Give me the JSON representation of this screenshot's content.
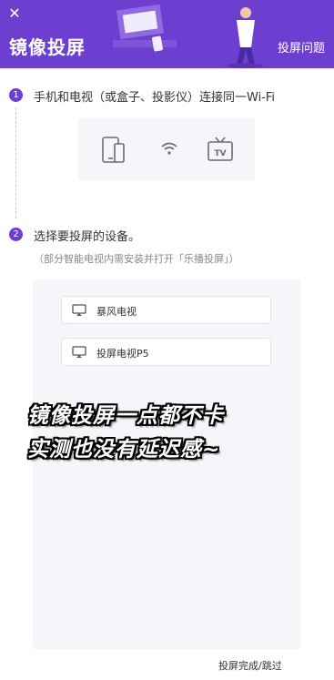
{
  "header": {
    "close_glyph": "✕",
    "title": "镜像投屏",
    "help_label": "投屏问题",
    "bg_color": "#6c3fd1"
  },
  "steps": [
    {
      "number": "1",
      "text": "手机和电视（或盒子、投影仪）连接同一Wi-Fi"
    },
    {
      "number": "2",
      "text": "选择要投屏的设备。",
      "note": "（部分智能电视内需安装并打开「乐播投屏」）"
    }
  ],
  "step1_icons": [
    "phone-icon",
    "wifi-icon",
    "tv-icon"
  ],
  "step1_tv_label": "TV",
  "devices": [
    {
      "name": "暴风电视",
      "icon": "tv-screen-icon"
    },
    {
      "name": "投屏电视P5",
      "icon": "tv-screen-icon"
    }
  ],
  "caption": {
    "line1": "镜像投屏一点都不卡",
    "line2": "实测也没有延迟感~"
  },
  "footer": {
    "done_label": "投屏完成/跳过"
  }
}
